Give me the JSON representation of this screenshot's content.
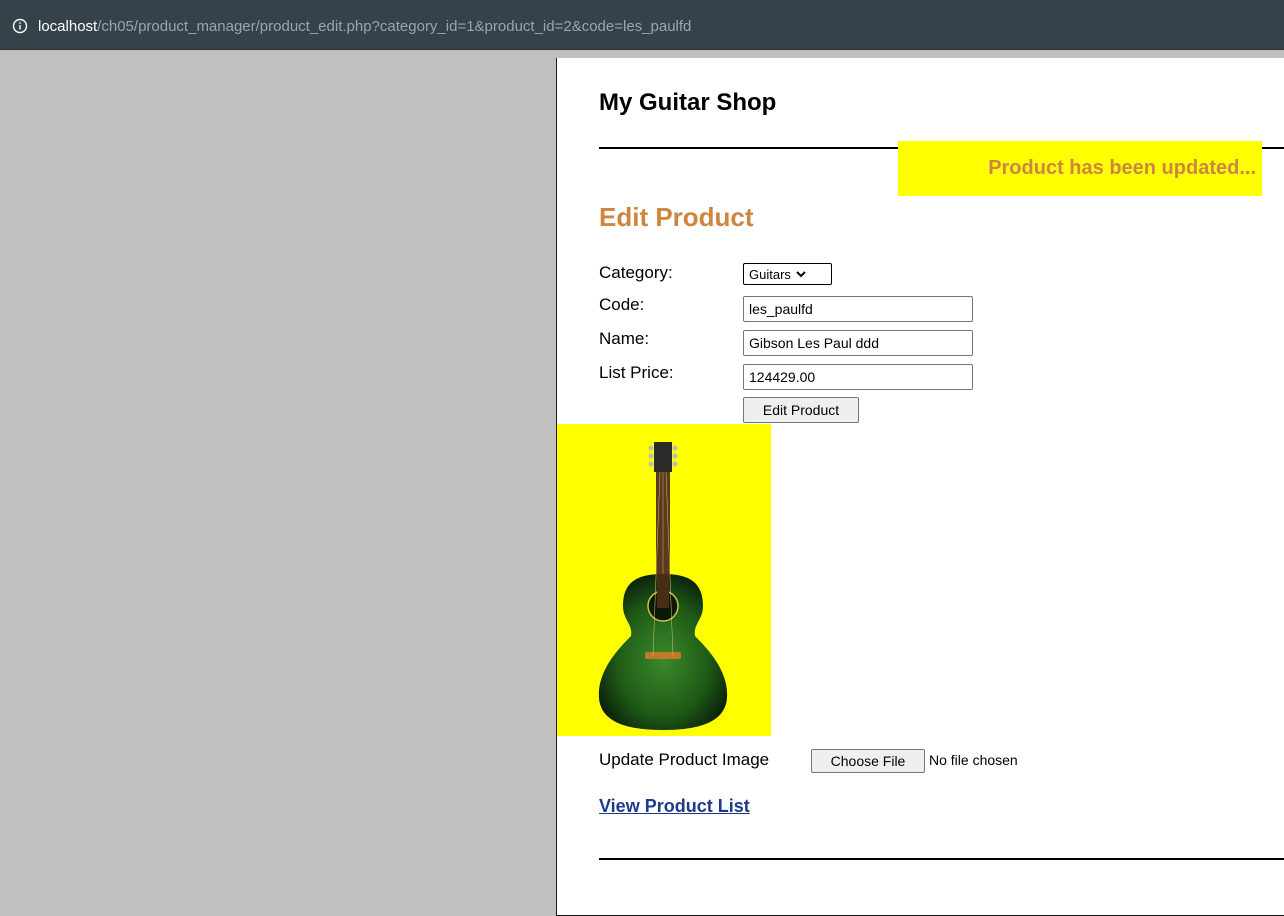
{
  "browser": {
    "url_host": "localhost",
    "url_path": "/ch05/product_manager/product_edit.php?category_id=1&product_id=2&code=les_paulfd"
  },
  "site": {
    "title": "My Guitar Shop"
  },
  "notice": {
    "message": "Product has been updated...",
    "background": "#ffff00",
    "color": "#cd853f"
  },
  "form": {
    "heading": "Edit Product",
    "category_label": "Category:",
    "category_value": "Guitars",
    "code_label": "Code:",
    "code_value": "les_paulfd",
    "name_label": "Name:",
    "name_value": "Gibson Les Paul ddd",
    "price_label": "List Price:",
    "price_value": "124429.00",
    "submit_label": "Edit Product"
  },
  "image_section": {
    "update_label": "Update Product Image",
    "choose_file_label": "Choose File",
    "no_file_text": "No file chosen"
  },
  "links": {
    "view_product_list": "View Product List"
  },
  "icons": {
    "info": "info-icon",
    "dropdown": "chevron-down-icon",
    "product": "guitar-icon"
  }
}
